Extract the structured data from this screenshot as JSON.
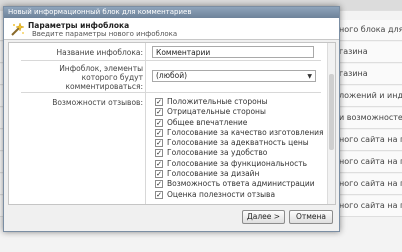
{
  "background": {
    "rows": [
      "ного блока для ко",
      "газина",
      "газина",
      "ложений и индекс",
      "и возможностей п",
      "ного сайта на при",
      "ного сайта на при",
      "ного сайта на при",
      "ного сайта на при"
    ]
  },
  "window": {
    "title": "Новый информационный блок для комментариев"
  },
  "header": {
    "title": "Параметры инфоблока",
    "subtitle": "Введите параметры нового инфоблока"
  },
  "form": {
    "name_label": "Название инфоблока:",
    "name_value": "Комментарии",
    "infoblock_label_1": "Инфоблок, элементы",
    "infoblock_label_2": "которого будут",
    "infoblock_label_3": "комментироваться:",
    "infoblock_value": "(любой)",
    "reviews_label": "Возможности отзывов:",
    "options": [
      {
        "label": "Положительные стороны",
        "checked": true
      },
      {
        "label": "Отрицательные стороны",
        "checked": true
      },
      {
        "label": "Общее впечатление",
        "checked": true
      },
      {
        "label": "Голосование за качество изготовления",
        "checked": true
      },
      {
        "label": "Голосование за адекватность цены",
        "checked": true
      },
      {
        "label": "Голосование за удобство",
        "checked": true
      },
      {
        "label": "Голосование за функциональность",
        "checked": true
      },
      {
        "label": "Голосование за дизайн",
        "checked": true
      },
      {
        "label": "Возможность ответа администрации",
        "checked": true
      },
      {
        "label": "Оценка полезности отзыва",
        "checked": true
      }
    ]
  },
  "footer": {
    "next_label": "Далее >",
    "cancel_label": "Отмена"
  },
  "icons": {
    "header": "magic-wand-icon",
    "select_arrow": "chevron-down-icon",
    "checkbox_mark": "check-icon"
  }
}
